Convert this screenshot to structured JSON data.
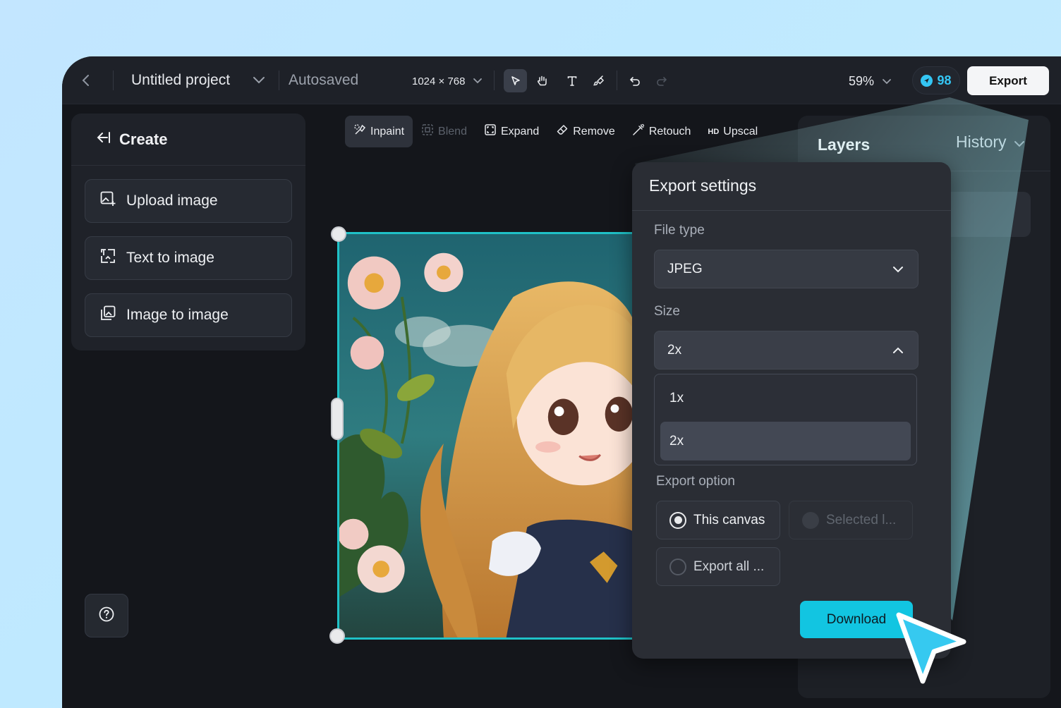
{
  "topbar": {
    "project_title": "Untitled project",
    "autosave_status": "Autosaved",
    "canvas_size": "1024 × 768",
    "tools": [
      "select-tool",
      "hand-tool",
      "text-tool",
      "brush-tool",
      "undo",
      "redo"
    ],
    "zoom": "59%",
    "credits": "98",
    "export_label": "Export"
  },
  "left_panel": {
    "title": "Create",
    "buttons": [
      {
        "label": "Upload image",
        "icon": "upload-image-icon"
      },
      {
        "label": "Text to image",
        "icon": "text-to-image-icon"
      },
      {
        "label": "Image to image",
        "icon": "image-to-image-icon"
      }
    ]
  },
  "edit_toolbar": {
    "inpaint": "Inpaint",
    "blend": "Blend",
    "expand": "Expand",
    "remove": "Remove",
    "retouch": "Retouch",
    "upscale_tag": "HD",
    "upscale": "Upscal"
  },
  "right_panel": {
    "layers_tab": "Layers",
    "history_tab": "History"
  },
  "export_settings": {
    "title": "Export settings",
    "file_type_label": "File type",
    "file_type_value": "JPEG",
    "size_label": "Size",
    "size_value": "2x",
    "size_options": [
      "1x",
      "2x"
    ],
    "export_option_label": "Export option",
    "options": {
      "this_canvas": "This canvas",
      "selected": "Selected l...",
      "export_all": "Export all ..."
    },
    "selected_option": "This canvas",
    "download_label": "Download"
  },
  "colors": {
    "accent": "#12c5e1",
    "credits": "#34c6f4",
    "canvas_border": "#1fc1c7",
    "background": "#14161b"
  }
}
